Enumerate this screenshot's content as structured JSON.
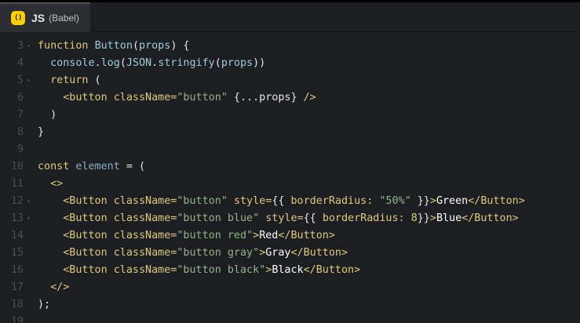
{
  "tab": {
    "icon": "js-badge-icon",
    "badge_text": "()",
    "title": "JS",
    "subtitle": "(Babel)"
  },
  "colors": {
    "background": "#1d1e22",
    "keyword": "#ddca7e",
    "string": "#96b38a",
    "identifier": "#9ccfd8",
    "text": "#ffffff"
  },
  "lines": [
    {
      "n": "3",
      "fold": true,
      "tokens": [
        [
          "kw",
          "function"
        ],
        [
          "pn",
          " "
        ],
        [
          "fn",
          "Button"
        ],
        [
          "pn",
          "("
        ],
        [
          "pr",
          "props"
        ],
        [
          "pn",
          ") {"
        ]
      ]
    },
    {
      "n": "4",
      "fold": false,
      "tokens": [
        [
          "pn",
          "  "
        ],
        [
          "fn",
          "console"
        ],
        [
          "pn",
          "."
        ],
        [
          "fn",
          "log"
        ],
        [
          "pn",
          "("
        ],
        [
          "fn",
          "JSON"
        ],
        [
          "pn",
          "."
        ],
        [
          "fn",
          "stringify"
        ],
        [
          "pn",
          "("
        ],
        [
          "pr",
          "props"
        ],
        [
          "pn",
          "))"
        ]
      ]
    },
    {
      "n": "5",
      "fold": true,
      "tokens": [
        [
          "pn",
          "  "
        ],
        [
          "kw",
          "return"
        ],
        [
          "pn",
          " ("
        ]
      ]
    },
    {
      "n": "6",
      "fold": false,
      "tokens": [
        [
          "pn",
          "    "
        ],
        [
          "tg",
          "<button"
        ],
        [
          "pn",
          " "
        ],
        [
          "at",
          "className="
        ],
        [
          "st",
          "\"button\""
        ],
        [
          "pn",
          " {...props} "
        ],
        [
          "tg",
          "/>"
        ]
      ]
    },
    {
      "n": "7",
      "fold": false,
      "tokens": [
        [
          "pn",
          "  )"
        ]
      ]
    },
    {
      "n": "8",
      "fold": false,
      "tokens": [
        [
          "pn",
          "}"
        ]
      ]
    },
    {
      "n": "9",
      "fold": false,
      "tokens": []
    },
    {
      "n": "10",
      "fold": false,
      "tokens": [
        [
          "kw",
          "const"
        ],
        [
          "pn",
          " "
        ],
        [
          "vr",
          "element"
        ],
        [
          "pn",
          " = ("
        ]
      ]
    },
    {
      "n": "11",
      "fold": false,
      "tokens": [
        [
          "pn",
          "  "
        ],
        [
          "tg",
          "<>"
        ]
      ]
    },
    {
      "n": "12",
      "fold": true,
      "tokens": [
        [
          "pn",
          "    "
        ],
        [
          "tg",
          "<Button"
        ],
        [
          "pn",
          " "
        ],
        [
          "at",
          "className="
        ],
        [
          "st",
          "\"button\""
        ],
        [
          "pn",
          " "
        ],
        [
          "at",
          "style="
        ],
        [
          "pn",
          "{{ "
        ],
        [
          "at",
          "borderRadius:"
        ],
        [
          "pn",
          " "
        ],
        [
          "st",
          "\"50%\""
        ],
        [
          "pn",
          " }}"
        ],
        [
          "tg",
          ">"
        ],
        [
          "tx",
          "Green"
        ],
        [
          "tg",
          "</Button>"
        ]
      ]
    },
    {
      "n": "13",
      "fold": true,
      "tokens": [
        [
          "pn",
          "    "
        ],
        [
          "tg",
          "<Button"
        ],
        [
          "pn",
          " "
        ],
        [
          "at",
          "className="
        ],
        [
          "st",
          "\"button blue\""
        ],
        [
          "pn",
          " "
        ],
        [
          "at",
          "style="
        ],
        [
          "pn",
          "{{ "
        ],
        [
          "at",
          "borderRadius:"
        ],
        [
          "pn",
          " "
        ],
        [
          "kw",
          "8"
        ],
        [
          "pn",
          "}}"
        ],
        [
          "tg",
          ">"
        ],
        [
          "tx",
          "Blue"
        ],
        [
          "tg",
          "</Button>"
        ]
      ]
    },
    {
      "n": "14",
      "fold": false,
      "tokens": [
        [
          "pn",
          "    "
        ],
        [
          "tg",
          "<Button"
        ],
        [
          "pn",
          " "
        ],
        [
          "at",
          "className="
        ],
        [
          "st",
          "\"button red\""
        ],
        [
          "tg",
          ">"
        ],
        [
          "tx",
          "Red"
        ],
        [
          "tg",
          "</Button>"
        ]
      ]
    },
    {
      "n": "15",
      "fold": false,
      "tokens": [
        [
          "pn",
          "    "
        ],
        [
          "tg",
          "<Button"
        ],
        [
          "pn",
          " "
        ],
        [
          "at",
          "className="
        ],
        [
          "st",
          "\"button gray\""
        ],
        [
          "tg",
          ">"
        ],
        [
          "tx",
          "Gray"
        ],
        [
          "tg",
          "</Button>"
        ]
      ]
    },
    {
      "n": "16",
      "fold": false,
      "tokens": [
        [
          "pn",
          "    "
        ],
        [
          "tg",
          "<Button"
        ],
        [
          "pn",
          " "
        ],
        [
          "at",
          "className="
        ],
        [
          "st",
          "\"button black\""
        ],
        [
          "tg",
          ">"
        ],
        [
          "tx",
          "Black"
        ],
        [
          "tg",
          "</Button>"
        ]
      ]
    },
    {
      "n": "17",
      "fold": false,
      "tokens": [
        [
          "pn",
          "  "
        ],
        [
          "tg",
          "</>"
        ]
      ]
    },
    {
      "n": "18",
      "fold": false,
      "tokens": [
        [
          "pn",
          ");"
        ]
      ]
    },
    {
      "n": "19",
      "fold": false,
      "tokens": []
    }
  ]
}
